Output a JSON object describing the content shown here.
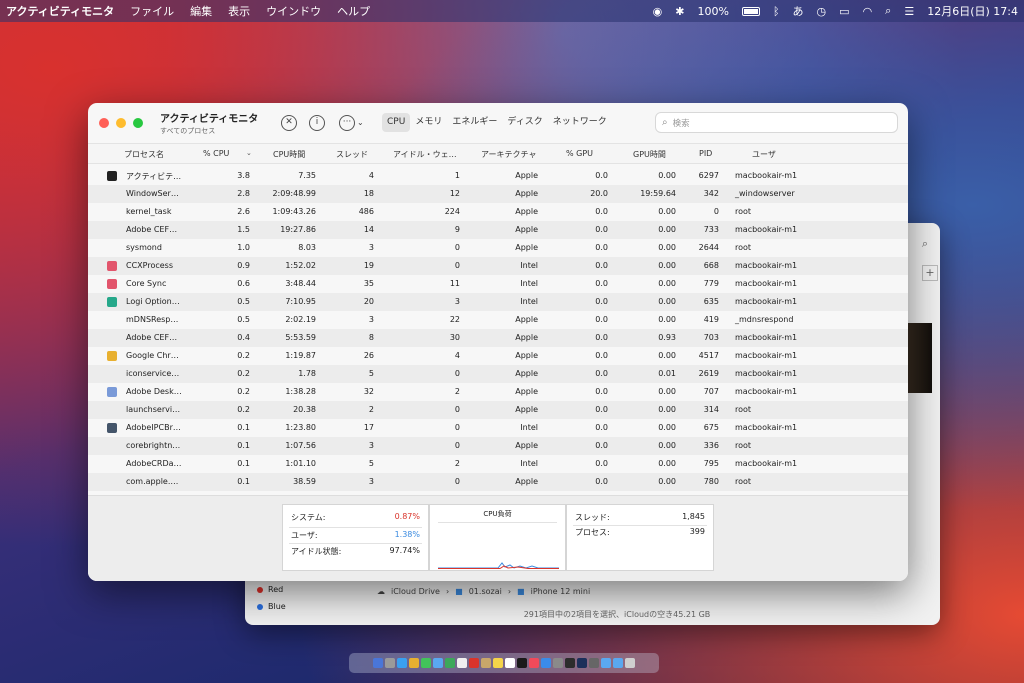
{
  "menubar": {
    "app_name": "アクティビティモニタ",
    "items": [
      "ファイル",
      "編集",
      "表示",
      "ウインドウ",
      "ヘルプ"
    ],
    "battery": "100%",
    "date_time": "12月6日(日)  17:4"
  },
  "window": {
    "title": "アクティビティモニタ",
    "subtitle": "すべてのプロセス",
    "tabs": [
      "CPU",
      "メモリ",
      "エネルギー",
      "ディスク",
      "ネットワーク"
    ],
    "search_placeholder": "検索"
  },
  "columns": [
    "プロセス名",
    "% CPU",
    "CPU時間",
    "スレッド",
    "アイドル・ウェ…",
    "アーキテクチャ",
    "% GPU",
    "GPU時間",
    "PID",
    "ユーザ"
  ],
  "processes": [
    {
      "name": "アクティビテ…",
      "cpu": "3.8",
      "cpu_time": "7.35",
      "threads": "4",
      "idle": "1",
      "arch": "Apple",
      "gpu": "0.0",
      "gpu_time": "0.00",
      "pid": "6297",
      "user": "macbookair-m1"
    },
    {
      "name": "WindowSer…",
      "cpu": "2.8",
      "cpu_time": "2:09:48.99",
      "threads": "18",
      "idle": "12",
      "arch": "Apple",
      "gpu": "20.0",
      "gpu_time": "19:59.64",
      "pid": "342",
      "user": "_windowserver"
    },
    {
      "name": "kernel_task",
      "cpu": "2.6",
      "cpu_time": "1:09:43.26",
      "threads": "486",
      "idle": "224",
      "arch": "Apple",
      "gpu": "0.0",
      "gpu_time": "0.00",
      "pid": "0",
      "user": "root"
    },
    {
      "name": "Adobe CEF…",
      "cpu": "1.5",
      "cpu_time": "19:27.86",
      "threads": "14",
      "idle": "9",
      "arch": "Apple",
      "gpu": "0.0",
      "gpu_time": "0.00",
      "pid": "733",
      "user": "macbookair-m1"
    },
    {
      "name": "sysmond",
      "cpu": "1.0",
      "cpu_time": "8.03",
      "threads": "3",
      "idle": "0",
      "arch": "Apple",
      "gpu": "0.0",
      "gpu_time": "0.00",
      "pid": "2644",
      "user": "root"
    },
    {
      "name": "CCXProcess",
      "cpu": "0.9",
      "cpu_time": "1:52.02",
      "threads": "19",
      "idle": "0",
      "arch": "Intel",
      "gpu": "0.0",
      "gpu_time": "0.00",
      "pid": "668",
      "user": "macbookair-m1"
    },
    {
      "name": "Core Sync",
      "cpu": "0.6",
      "cpu_time": "3:48.44",
      "threads": "35",
      "idle": "11",
      "arch": "Intel",
      "gpu": "0.0",
      "gpu_time": "0.00",
      "pid": "779",
      "user": "macbookair-m1"
    },
    {
      "name": "Logi Option…",
      "cpu": "0.5",
      "cpu_time": "7:10.95",
      "threads": "20",
      "idle": "3",
      "arch": "Intel",
      "gpu": "0.0",
      "gpu_time": "0.00",
      "pid": "635",
      "user": "macbookair-m1"
    },
    {
      "name": "mDNSResp…",
      "cpu": "0.5",
      "cpu_time": "2:02.19",
      "threads": "3",
      "idle": "22",
      "arch": "Apple",
      "gpu": "0.0",
      "gpu_time": "0.00",
      "pid": "419",
      "user": "_mdnsrespond"
    },
    {
      "name": "Adobe CEF…",
      "cpu": "0.4",
      "cpu_time": "5:53.59",
      "threads": "8",
      "idle": "30",
      "arch": "Apple",
      "gpu": "0.0",
      "gpu_time": "0.93",
      "pid": "703",
      "user": "macbookair-m1"
    },
    {
      "name": "Google Chr…",
      "cpu": "0.2",
      "cpu_time": "1:19.87",
      "threads": "26",
      "idle": "4",
      "arch": "Apple",
      "gpu": "0.0",
      "gpu_time": "0.00",
      "pid": "4517",
      "user": "macbookair-m1"
    },
    {
      "name": "iconservice…",
      "cpu": "0.2",
      "cpu_time": "1.78",
      "threads": "5",
      "idle": "0",
      "arch": "Apple",
      "gpu": "0.0",
      "gpu_time": "0.01",
      "pid": "2619",
      "user": "macbookair-m1"
    },
    {
      "name": "Adobe Desk…",
      "cpu": "0.2",
      "cpu_time": "1:38.28",
      "threads": "32",
      "idle": "2",
      "arch": "Apple",
      "gpu": "0.0",
      "gpu_time": "0.00",
      "pid": "707",
      "user": "macbookair-m1"
    },
    {
      "name": "launchservi…",
      "cpu": "0.2",
      "cpu_time": "20.38",
      "threads": "2",
      "idle": "0",
      "arch": "Apple",
      "gpu": "0.0",
      "gpu_time": "0.00",
      "pid": "314",
      "user": "root"
    },
    {
      "name": "AdobeIPCBr…",
      "cpu": "0.1",
      "cpu_time": "1:23.80",
      "threads": "17",
      "idle": "0",
      "arch": "Intel",
      "gpu": "0.0",
      "gpu_time": "0.00",
      "pid": "675",
      "user": "macbookair-m1"
    },
    {
      "name": "corebrightn…",
      "cpu": "0.1",
      "cpu_time": "1:07.56",
      "threads": "3",
      "idle": "0",
      "arch": "Apple",
      "gpu": "0.0",
      "gpu_time": "0.00",
      "pid": "336",
      "user": "root"
    },
    {
      "name": "AdobeCRDa…",
      "cpu": "0.1",
      "cpu_time": "1:01.10",
      "threads": "5",
      "idle": "2",
      "arch": "Intel",
      "gpu": "0.0",
      "gpu_time": "0.00",
      "pid": "795",
      "user": "macbookair-m1"
    },
    {
      "name": "com.apple.…",
      "cpu": "0.1",
      "cpu_time": "38.59",
      "threads": "3",
      "idle": "0",
      "arch": "Apple",
      "gpu": "0.0",
      "gpu_time": "0.00",
      "pid": "780",
      "user": "root"
    }
  ],
  "summary": {
    "system_label": "システム:",
    "system_value": "0.87%",
    "user_label": "ユーザ:",
    "user_value": "1.38%",
    "idle_label": "アイドル状態:",
    "idle_value": "97.74%",
    "load_title": "CPU負荷",
    "threads_label": "スレッド:",
    "threads_value": "1,845",
    "processes_label": "プロセス:",
    "processes_value": "399"
  },
  "finder": {
    "tags": [
      "Red",
      "Blue"
    ],
    "path": [
      "iCloud Drive",
      "01.sozai",
      "iPhone 12 mini"
    ],
    "status": "291項目中の2項目を選択、iCloudの空き45.21 GB"
  },
  "colors": {
    "system": "#d9342b",
    "user": "#3b8be0",
    "close": "#ff5f57",
    "minimize": "#febc2e",
    "zoom": "#28c840"
  }
}
